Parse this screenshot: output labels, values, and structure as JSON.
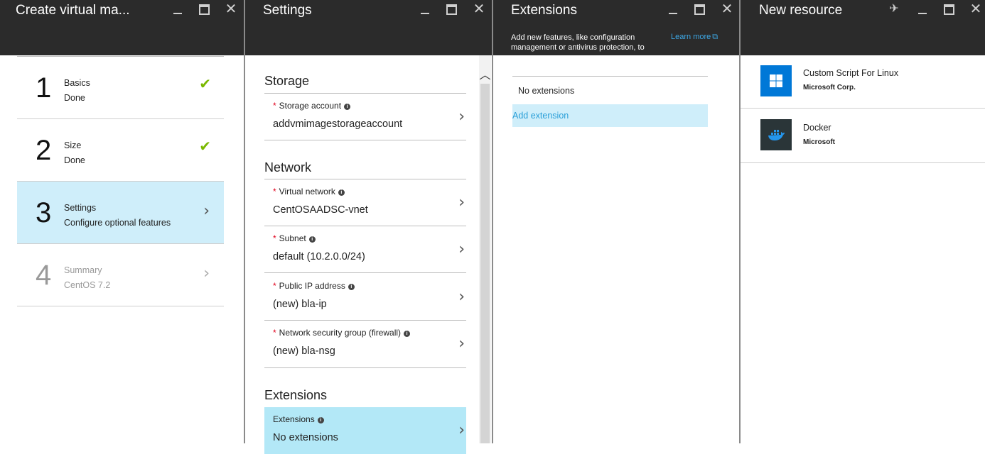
{
  "blade1": {
    "title": "Create virtual ma...",
    "steps": [
      {
        "num": "1",
        "title": "Basics",
        "sub": "Done",
        "state": "done"
      },
      {
        "num": "2",
        "title": "Size",
        "sub": "Done",
        "state": "done"
      },
      {
        "num": "3",
        "title": "Settings",
        "sub": "Configure optional features",
        "state": "active"
      },
      {
        "num": "4",
        "title": "Summary",
        "sub": "CentOS 7.2",
        "state": "disabled"
      }
    ]
  },
  "blade2": {
    "title": "Settings",
    "storage": {
      "heading": "Storage",
      "storage_account_label": "Storage account",
      "storage_account_value": "addvmimagestorageaccount"
    },
    "network": {
      "heading": "Network",
      "vnet_label": "Virtual network",
      "vnet_value": "CentOSAADSC-vnet",
      "subnet_label": "Subnet",
      "subnet_value": "default (10.2.0.0/24)",
      "pip_label": "Public IP address",
      "pip_value": "(new) bla-ip",
      "nsg_label": "Network security group (firewall)",
      "nsg_value": "(new) bla-nsg"
    },
    "extensions": {
      "heading": "Extensions",
      "label": "Extensions",
      "value": "No extensions"
    }
  },
  "blade3": {
    "title": "Extensions",
    "description": "Add new features, like configuration management or antivirus protection, to",
    "learn_more": "Learn more",
    "no_extensions": "No extensions",
    "add_extension": "Add extension"
  },
  "blade4": {
    "title": "New resource",
    "items": [
      {
        "name": "Custom Script For Linux",
        "publisher": "Microsoft Corp.",
        "icon": "windows-icon"
      },
      {
        "name": "Docker",
        "publisher": "Microsoft",
        "icon": "docker-whale-icon"
      }
    ]
  },
  "colors": {
    "header_bg": "#2b2b2b",
    "active_bg": "#cfeefa",
    "selected_field_bg": "#b3e8f7",
    "check_green": "#7ab800",
    "link_blue": "#3da8e6",
    "required_red": "#e0001b",
    "windows_blue": "#0078d7"
  }
}
